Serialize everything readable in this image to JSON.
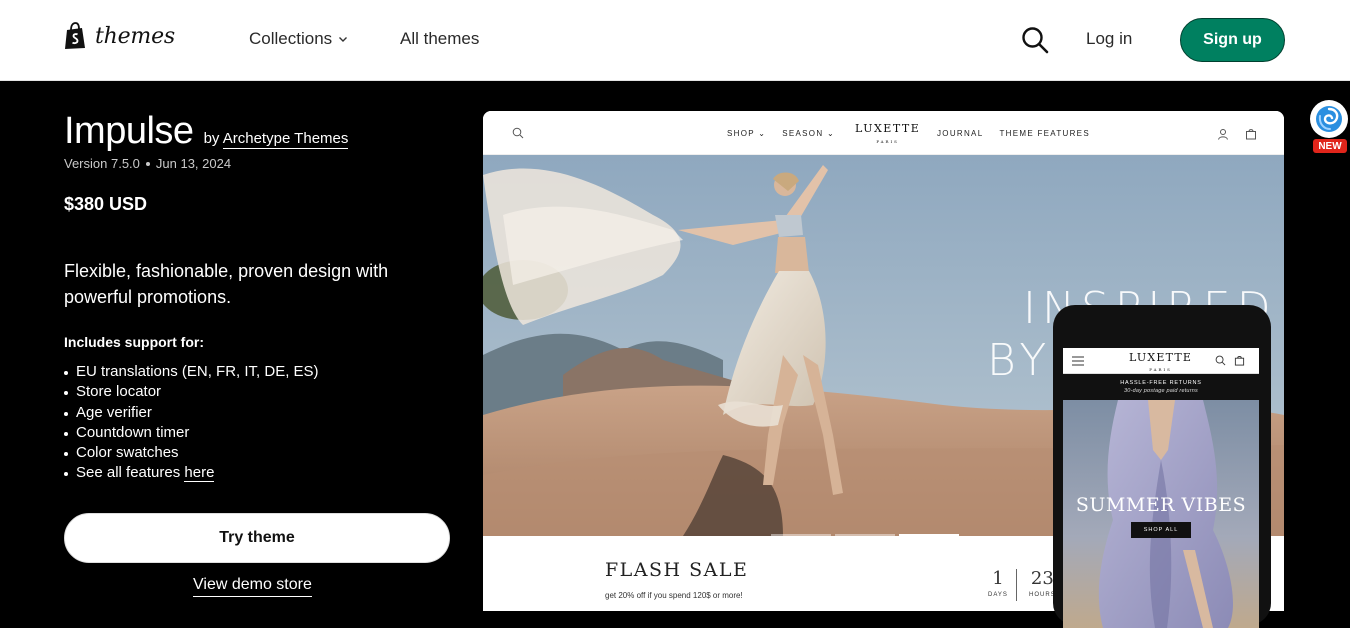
{
  "nav": {
    "brand": "themes",
    "collections": "Collections",
    "all_themes": "All themes",
    "login": "Log in",
    "signup": "Sign up"
  },
  "theme": {
    "name": "Impulse",
    "by_prefix": "by",
    "author": "Archetype Themes",
    "version": "Version 7.5.0",
    "date": "Jun 13, 2024",
    "price": "$380 USD",
    "tagline": "Flexible, fashionable, proven design with powerful promotions.",
    "support_heading": "Includes support for:",
    "features": [
      "EU translations (EN, FR, IT, DE, ES)",
      "Store locator",
      "Age verifier",
      "Countdown timer",
      "Color swatches"
    ],
    "see_all_prefix": "See all features",
    "see_all_link": "here",
    "try_button": "Try theme",
    "demo_link": "View demo store"
  },
  "preview": {
    "menu_left": [
      "SHOP",
      "SEASON"
    ],
    "logo": "LUXETTE",
    "logo_sub": "PARIS",
    "menu_right": [
      "JOURNAL",
      "THEME FEATURES"
    ],
    "hero_line1": "INSPIRED",
    "hero_line2": "BY",
    "flash_title": "FLASH SALE",
    "flash_sub": "get 20% off if you spend 120$ or more!",
    "count_days_value": "1",
    "count_days_label": "DAYS",
    "count_hours_value": "23",
    "count_hours_label": "HOURS"
  },
  "phone": {
    "logo": "LUXETTE",
    "logo_sub": "PARIS",
    "banner_line1": "HASSLE-FREE RETURNS",
    "banner_line2": "30-day postage paid returns",
    "hero_title": "SUMMER VIBES",
    "hero_button": "SHOP ALL"
  },
  "extension_badge": "NEW",
  "colors": {
    "signup_bg": "#008060",
    "badge_red": "#e0251b"
  }
}
